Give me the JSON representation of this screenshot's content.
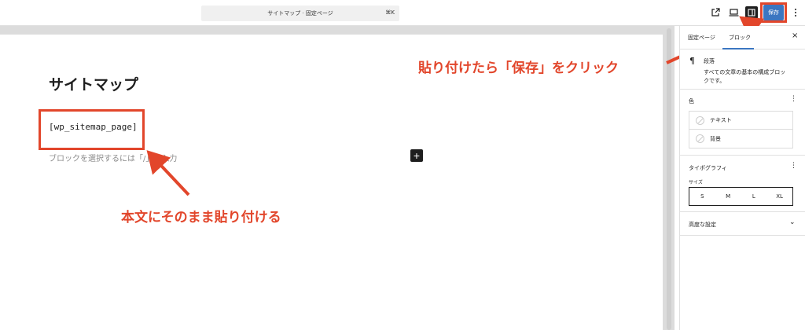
{
  "toolbar": {
    "command_title": "サイトマップ · 固定ページ",
    "command_shortcut": "⌘K",
    "save_label": "保存",
    "icons": [
      "external-link-icon",
      "desktop-preview-icon",
      "sidebar-toggle-icon",
      "more-options-icon"
    ]
  },
  "editor": {
    "page_title": "サイトマップ",
    "shortcode": "[wp_sitemap_page]",
    "placeholder": "ブロックを選択するには「/」を入力",
    "add_block_symbol": "+"
  },
  "annotations": {
    "save_instruction": "貼り付けたら「保存」をクリック",
    "paste_instruction": "本文にそのまま貼り付ける",
    "color": "#e2462b"
  },
  "sidebar": {
    "tabs": [
      "固定ページ",
      "ブロック"
    ],
    "active_tab": "ブロック",
    "close_symbol": "×",
    "block": {
      "icon": "¶",
      "name": "段落",
      "description": "すべての文章の基本の構成ブロックです。"
    },
    "color_section": {
      "heading": "色",
      "items": [
        "テキスト",
        "背景"
      ]
    },
    "typography_section": {
      "heading": "タイポグラフィ",
      "size_label": "サイズ",
      "sizes": [
        "S",
        "M",
        "L",
        "XL"
      ]
    },
    "advanced_section": {
      "heading": "高度な設定",
      "chevron": "⌄"
    }
  },
  "colors": {
    "accent": "#3b76c1",
    "annotation": "#e2462b"
  }
}
